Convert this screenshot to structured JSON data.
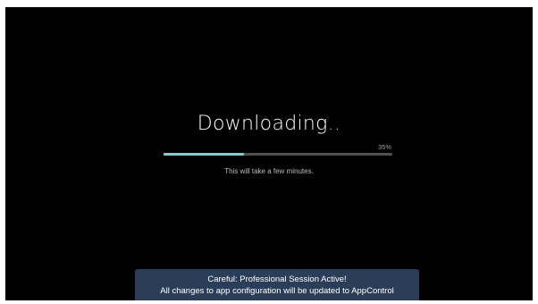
{
  "download": {
    "title": "Downloading",
    "dots": "..",
    "progress_percent": 35,
    "progress_label": "35%",
    "subtitle": "This will take a few minutes."
  },
  "notice": {
    "line1": "Careful: Professional Session Active!",
    "line2": "All changes to app configuration will be updated to AppControl"
  },
  "colors": {
    "background": "#000000",
    "progress_fill": "#82cdd2",
    "progress_track": "#505050",
    "notice_background": "#2b3e59"
  }
}
